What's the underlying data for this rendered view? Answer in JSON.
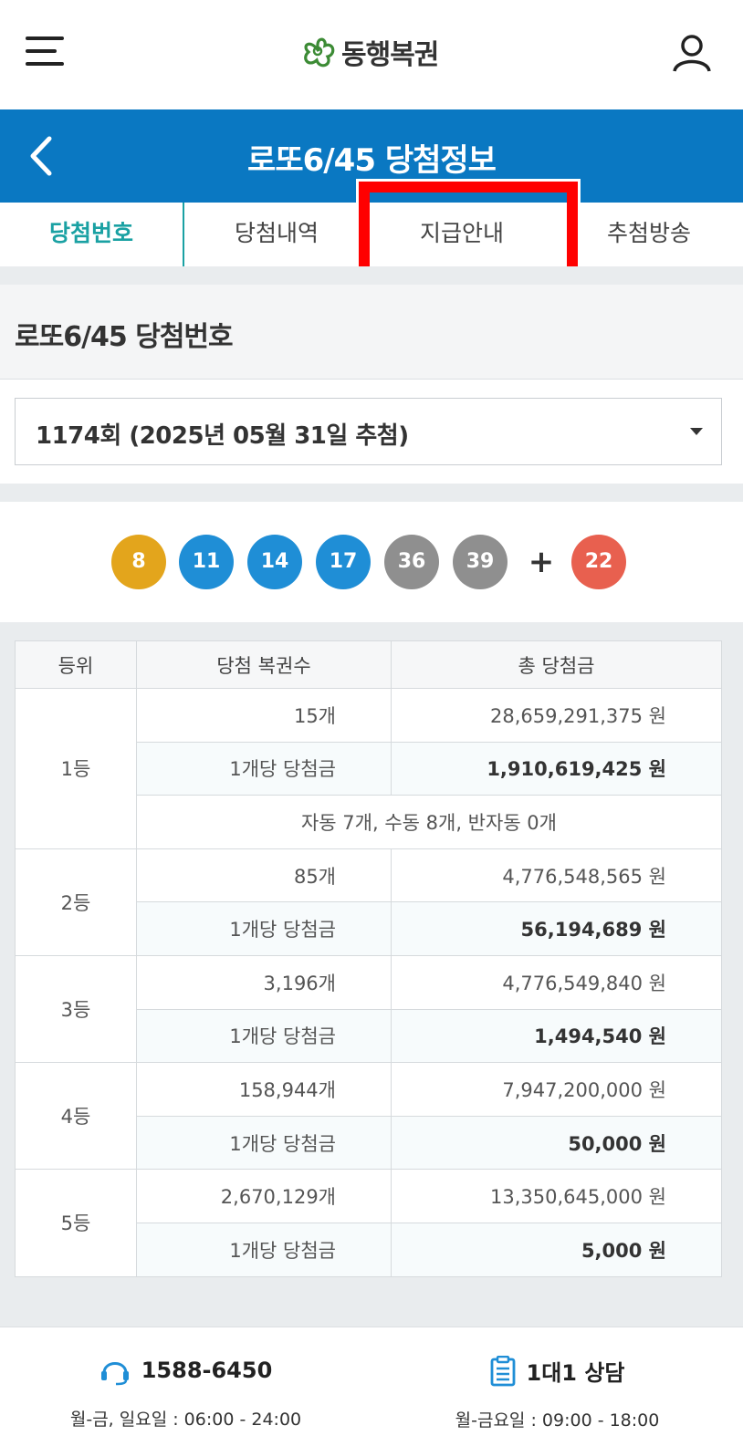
{
  "header": {
    "logo_text": "동행복권",
    "menu_icon": "hamburger-icon",
    "user_icon": "user-icon"
  },
  "titlebar": {
    "title": "로또6/45 당첨정보",
    "bg_color": "#0a78c2"
  },
  "tabs": [
    {
      "label": "당첨번호",
      "active": true
    },
    {
      "label": "당첨내역",
      "active": false
    },
    {
      "label": "지급안내",
      "active": false,
      "highlighted": true
    },
    {
      "label": "추첨방송",
      "active": false
    }
  ],
  "section": {
    "title": "로또6/45 당첨번호"
  },
  "round_select": {
    "selected": "1174회 (2025년 05월 31일 추첨)"
  },
  "numbers": {
    "main": [
      {
        "value": "8",
        "color": "#e3a51c"
      },
      {
        "value": "11",
        "color": "#1f8ed6"
      },
      {
        "value": "14",
        "color": "#1f8ed6"
      },
      {
        "value": "17",
        "color": "#1f8ed6"
      },
      {
        "value": "36",
        "color": "#8f8f8f"
      },
      {
        "value": "39",
        "color": "#8f8f8f"
      }
    ],
    "plus": "+",
    "bonus": {
      "value": "22",
      "color": "#e8604f"
    }
  },
  "table": {
    "headers": [
      "등위",
      "당첨 복권수",
      "총 당첨금"
    ],
    "ranks": [
      {
        "rank": "1등",
        "count": "15개",
        "total": "28,659,291,375 원",
        "per_label": "1개당 당첨금",
        "per_amount": "1,910,619,425 원",
        "note": "자동 7개, 수동 8개, 반자동 0개"
      },
      {
        "rank": "2등",
        "count": "85개",
        "total": "4,776,548,565 원",
        "per_label": "1개당 당첨금",
        "per_amount": "56,194,689 원"
      },
      {
        "rank": "3등",
        "count": "3,196개",
        "total": "4,776,549,840 원",
        "per_label": "1개당 당첨금",
        "per_amount": "1,494,540 원"
      },
      {
        "rank": "4등",
        "count": "158,944개",
        "total": "7,947,200,000 원",
        "per_label": "1개당 당첨금",
        "per_amount": "50,000 원"
      },
      {
        "rank": "5등",
        "count": "2,670,129개",
        "total": "13,350,645,000 원",
        "per_label": "1개당 당첨금",
        "per_amount": "5,000 원"
      }
    ]
  },
  "footer": {
    "phone": {
      "icon": "headset-icon",
      "label": "1588-6450",
      "hours": "월-금, 일요일 : 06:00 - 24:00"
    },
    "consult": {
      "icon": "clipboard-icon",
      "label": "1대1 상담",
      "hours": "월-금요일 : 09:00 - 18:00"
    }
  }
}
